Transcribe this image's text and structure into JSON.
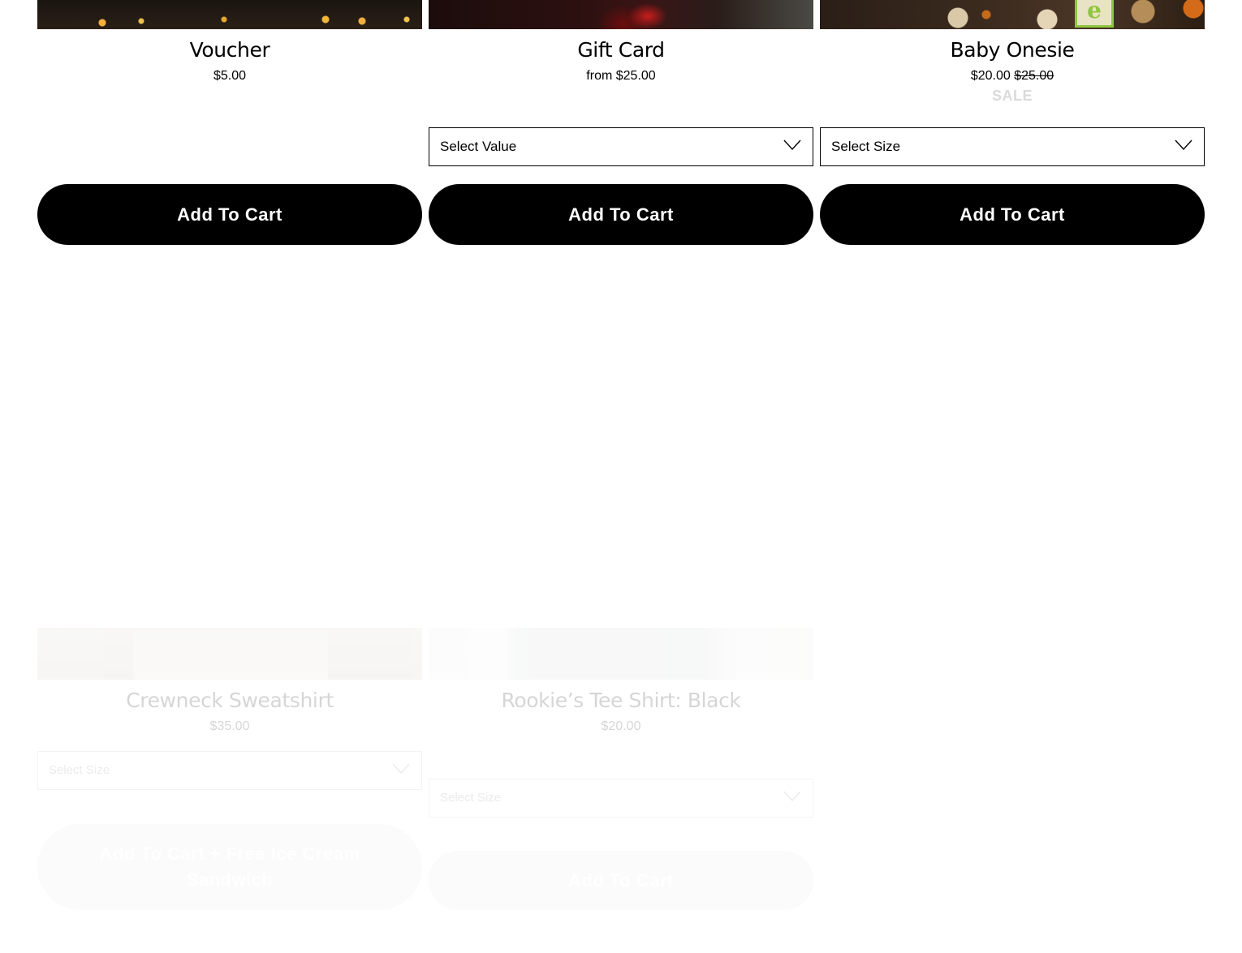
{
  "products": [
    {
      "title": "Voucher",
      "price": "$5.00",
      "button_label": "Add To Cart",
      "image_icon": "holiday-lights-image"
    },
    {
      "title": "Gift Card",
      "price": "from $25.00",
      "select_placeholder": "Select Value",
      "button_label": "Add To Cart",
      "image_icon": "gift-card-image"
    },
    {
      "title": "Baby Onesie",
      "price": "$20.00",
      "compare_price": "$25.00",
      "badge": "SALE",
      "block_letter": "e",
      "select_placeholder": "Select Size",
      "button_label": "Add To Cart",
      "image_icon": "cookies-image"
    },
    {
      "title": "Crewneck Sweatshirt",
      "price": "$35.00",
      "select_placeholder": "Select Size",
      "button_label": "Add To Cart + Free Ice Cream Sandwich",
      "image_icon": "sweatshirt-image"
    },
    {
      "title": "Rookie’s Tee Shirt: Black",
      "price": "$20.00",
      "select_placeholder": "Select Size",
      "button_label": "Add To Cart",
      "image_icon": "tee-shirt-image"
    }
  ],
  "colors": {
    "button_bg": "#000000",
    "button_text": "#ffffff",
    "sale_badge": "#dadada"
  }
}
